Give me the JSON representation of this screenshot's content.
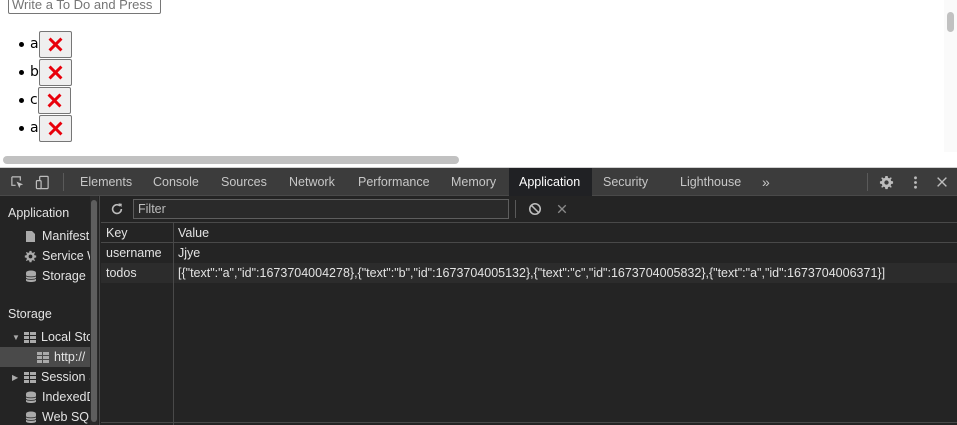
{
  "page": {
    "input_placeholder": "Write a To Do and Press",
    "todos": [
      {
        "text": "a"
      },
      {
        "text": "b"
      },
      {
        "text": "c"
      },
      {
        "text": "a"
      }
    ],
    "delete_icon": "close-icon",
    "delete_color": "#e8000b"
  },
  "devtools": {
    "tabs": [
      {
        "label": "Elements"
      },
      {
        "label": "Console"
      },
      {
        "label": "Sources"
      },
      {
        "label": "Network"
      },
      {
        "label": "Performance"
      },
      {
        "label": "Memory"
      },
      {
        "label": "Application",
        "active": true
      },
      {
        "label": "Security"
      },
      {
        "label": "Lighthouse"
      }
    ],
    "more_tabs": "»",
    "sidebar": {
      "application_section": "Application",
      "application_items": [
        {
          "label": "Manifest",
          "icon": "document-icon"
        },
        {
          "label": "Service Workers",
          "icon": "gear-icon"
        },
        {
          "label": "Storage",
          "icon": "database-icon"
        }
      ],
      "storage_section": "Storage",
      "storage_items": [
        {
          "label": "Local Storage",
          "icon": "table-icon",
          "expanded": true
        },
        {
          "label": "http://",
          "icon": "table-icon",
          "selected": true
        },
        {
          "label": "Session Storage",
          "icon": "table-icon",
          "expanded": false
        },
        {
          "label": "IndexedDB",
          "icon": "database-icon"
        },
        {
          "label": "Web SQL",
          "icon": "database-icon"
        }
      ]
    },
    "toolbar": {
      "filter_placeholder": "Filter"
    },
    "table": {
      "headers": {
        "key": "Key",
        "value": "Value"
      },
      "rows": [
        {
          "key": "username",
          "value": "Jjye"
        },
        {
          "key": "todos",
          "value": "[{\"text\":\"a\",\"id\":1673704004278},{\"text\":\"b\",\"id\":1673704005132},{\"text\":\"c\",\"id\":1673704005832},{\"text\":\"a\",\"id\":1673704006371}]"
        }
      ]
    },
    "colors": {
      "panel_bg": "#242424",
      "tabbar_bg": "#3c3c3c",
      "active_tab_bg": "#202124"
    }
  }
}
